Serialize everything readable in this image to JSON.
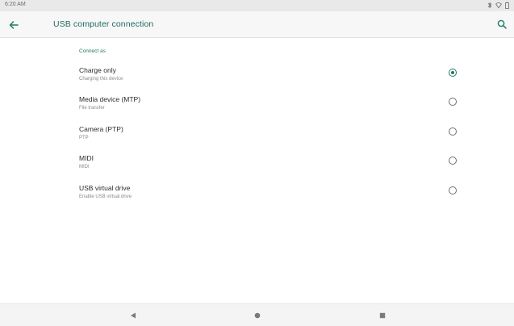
{
  "status_bar": {
    "time": "6:20 AM",
    "icons": [
      "bluetooth-icon",
      "wifi-icon",
      "battery-icon"
    ]
  },
  "toolbar": {
    "title": "USB computer connection",
    "back_icon": "arrow-back-icon",
    "search_icon": "search-icon",
    "accent_color": "#1f6b5d"
  },
  "content": {
    "section_label": "Connect as",
    "options": [
      {
        "title": "Charge only",
        "subtitle": "Charging this device",
        "selected": true
      },
      {
        "title": "Media device (MTP)",
        "subtitle": "File transfer",
        "selected": false
      },
      {
        "title": "Camera (PTP)",
        "subtitle": "PTP",
        "selected": false
      },
      {
        "title": "MIDI",
        "subtitle": "MIDI",
        "selected": false
      },
      {
        "title": "USB virtual drive",
        "subtitle": "Enable USB virtual drive",
        "selected": false
      }
    ]
  },
  "navigation_bar": {
    "buttons": [
      "back-triangle-icon",
      "home-circle-icon",
      "recents-square-icon"
    ]
  }
}
